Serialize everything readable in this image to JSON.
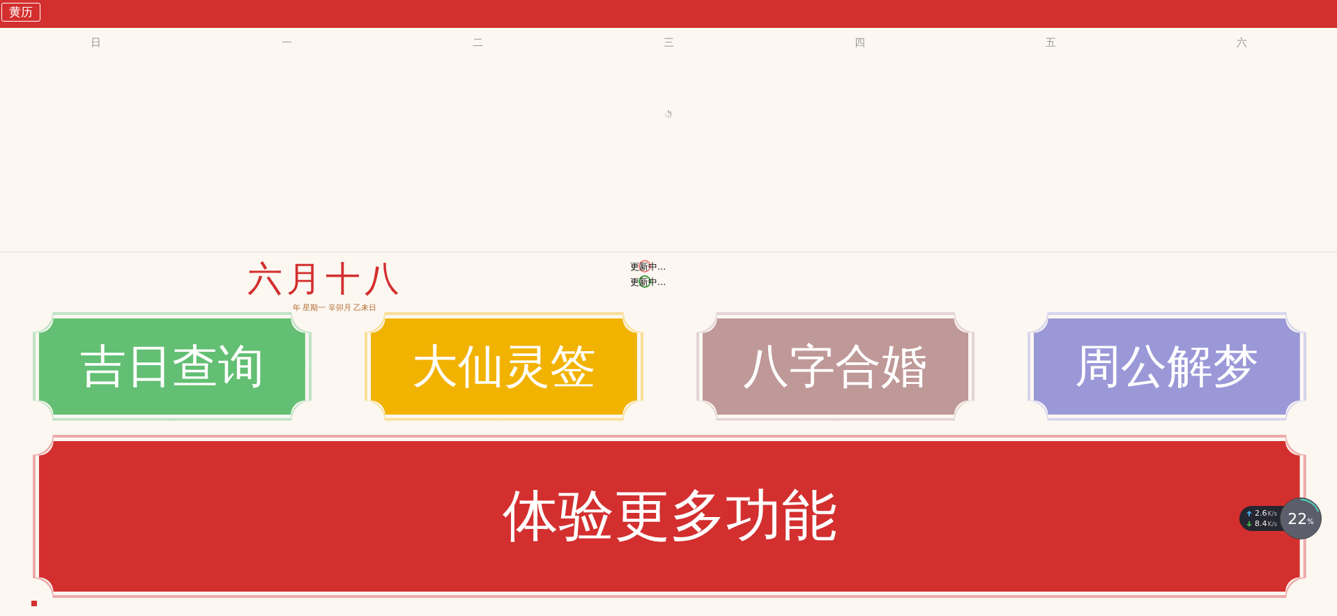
{
  "header": {
    "title": "黄历"
  },
  "weekdays": [
    "日",
    "一",
    "二",
    "三",
    "四",
    "五",
    "六"
  ],
  "lunar_date": "六月十八",
  "date_detail": "年 星期一 辛卯月 乙未日",
  "sync_status": [
    {
      "label": "更新中...",
      "color": "#f08080"
    },
    {
      "label": "更新中...",
      "color": "#3d9a3d"
    }
  ],
  "features": [
    {
      "label": "吉日查询",
      "color": "#63bf73"
    },
    {
      "label": "大仙灵签",
      "color": "#f2b200"
    },
    {
      "label": "八字合婚",
      "color": "#bf9898"
    },
    {
      "label": "周公解梦",
      "color": "#9b98d8"
    }
  ],
  "main_button": {
    "label": "体验更多功能",
    "color": "#d32f2f"
  },
  "network_monitor": {
    "upload": "2.6",
    "download": "8.4",
    "upload_unit": "K/s",
    "download_unit": "K/s",
    "load": "22",
    "load_unit": "%"
  }
}
